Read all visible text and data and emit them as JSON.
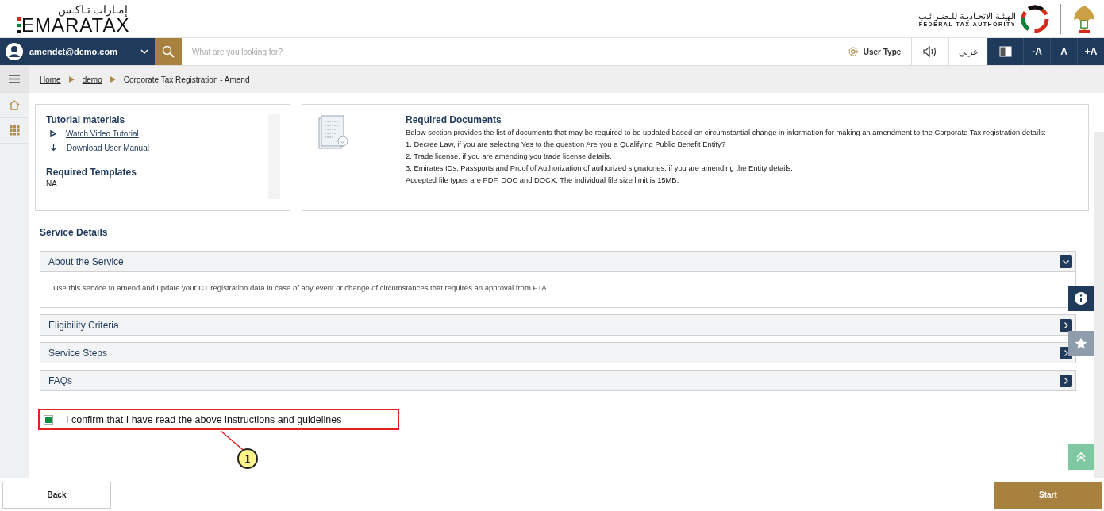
{
  "header": {
    "logo_arabic": "إمـارات تـاكـس",
    "logo": "EMARATAX",
    "authority_arabic": "الهيئـة الاتحـاديـة للـضـرائـب",
    "authority": "FEDERAL TAX AUTHORITY"
  },
  "nav": {
    "user": "amendct@demo.com",
    "search": {
      "placeholder": "What are you looking for?"
    },
    "user_type": "User Type",
    "language": "عربي",
    "font_buttons": [
      "-A",
      "A",
      "+A"
    ]
  },
  "breadcrumb": [
    {
      "label": "Home",
      "link": true
    },
    {
      "label": "demo",
      "link": true
    },
    {
      "label": "Corporate Tax Registration - Amend",
      "link": false
    }
  ],
  "tutorial": {
    "title": "Tutorial materials",
    "links": [
      {
        "kind": "video",
        "label": "Watch Video Tutorial"
      },
      {
        "kind": "download",
        "label": "Download User Manual"
      }
    ],
    "templates_title": "Required Templates",
    "templates_value": "NA"
  },
  "required_documents": {
    "title": "Required Documents",
    "intro": "Below section provides the list of documents that may be required to be updated based on circumstantial change in information for making an amendment to the Corporate Tax registration details:",
    "items": [
      "1. Decree Law, if you are selecting Yes to the question Are you a Qualifying Public Benefit Entity?",
      "2. Trade license, if you are amending you trade license details.",
      "3. Emirates IDs, Passports and Proof of Authorization of authorized signatories, if you are amending the Entity details."
    ],
    "note": "Accepted file types are PDF, DOC and DOCX. The individual file size limit is 15MB."
  },
  "service_details": {
    "title": "Service Details",
    "sections": [
      {
        "title": "About the Service",
        "expanded": true,
        "body": "Use this service to amend and update your CT registration data in case of any event or change of circumstances that requires an approval from FTA"
      },
      {
        "title": "Eligibility Criteria",
        "expanded": false
      },
      {
        "title": "Service Steps",
        "expanded": false
      },
      {
        "title": "FAQs",
        "expanded": false
      }
    ]
  },
  "confirmation": {
    "label": "I confirm that I have read the above instructions and guidelines",
    "checked": true
  },
  "annotation": {
    "number": "1"
  },
  "footer": {
    "buttons": [
      {
        "label": "Back",
        "kind": "secondary"
      },
      {
        "label": "Start",
        "kind": "primary"
      }
    ]
  }
}
